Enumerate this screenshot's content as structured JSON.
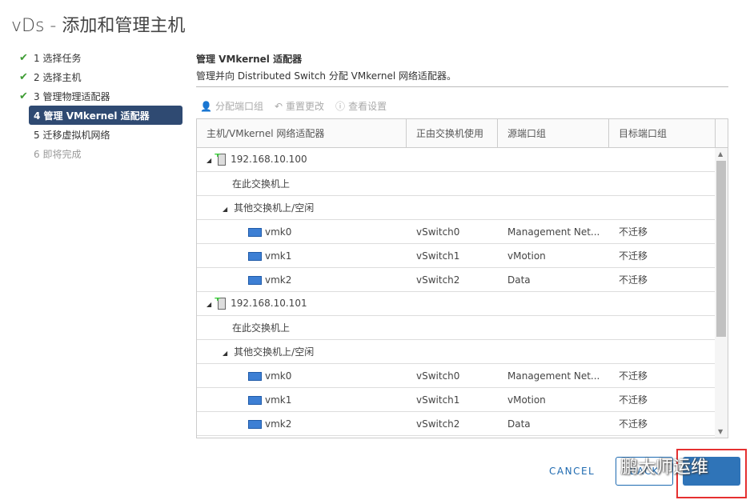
{
  "title": "vDs - 添加和管理主机",
  "steps": [
    {
      "label": "1 选择任务",
      "state": "done"
    },
    {
      "label": "2 选择主机",
      "state": "done"
    },
    {
      "label": "3 管理物理适配器",
      "state": "done"
    },
    {
      "label": "4 管理 VMkernel 适配器",
      "state": "active"
    },
    {
      "label": "5 迁移虚拟机网络",
      "state": "pending"
    },
    {
      "label": "6 即将完成",
      "state": "disabled"
    }
  ],
  "main": {
    "heading": "管理 VMkernel 适配器",
    "description": "管理并向 Distributed Switch 分配 VMkernel 网络适配器。",
    "toolbar": [
      {
        "label": "分配端口组",
        "icon": "assign-icon"
      },
      {
        "label": "重置更改",
        "icon": "undo-icon"
      },
      {
        "label": "查看设置",
        "icon": "info-icon"
      }
    ],
    "columns": [
      "主机/VMkernel 网络适配器",
      "正由交换机使用",
      "源端口组",
      "目标端口组"
    ],
    "hosts": [
      {
        "name": "192.168.10.100",
        "on_switch": "在此交换机上",
        "other": "其他交换机上/空闲",
        "adapters": [
          [
            "vmk0",
            "vSwitch0",
            "Management Net...",
            "不迁移"
          ],
          [
            "vmk1",
            "vSwitch1",
            "vMotion",
            "不迁移"
          ],
          [
            "vmk2",
            "vSwitch2",
            "Data",
            "不迁移"
          ]
        ]
      },
      {
        "name": "192.168.10.101",
        "on_switch": "在此交换机上",
        "other": "其他交换机上/空闲",
        "adapters": [
          [
            "vmk0",
            "vSwitch0",
            "Management Net...",
            "不迁移"
          ],
          [
            "vmk1",
            "vSwitch1",
            "vMotion",
            "不迁移"
          ],
          [
            "vmk2",
            "vSwitch2",
            "Data",
            "不迁移"
          ]
        ]
      }
    ]
  },
  "footer": {
    "cancel": "CANCEL",
    "back": "BACK"
  },
  "watermark": "鹏大师运维",
  "colors": {
    "accent": "#2f74b8",
    "active_step": "#2f4a72",
    "highlight": "#e53030"
  }
}
